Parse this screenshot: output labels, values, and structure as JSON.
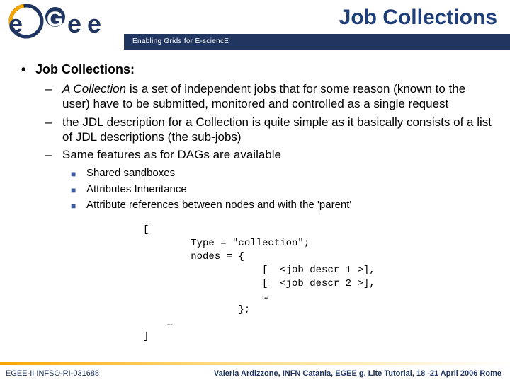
{
  "header": {
    "title": "Job Collections",
    "tagline": "Enabling Grids for E-sciencE",
    "logo_letters": [
      "e",
      "G",
      "e",
      "e"
    ]
  },
  "content": {
    "h1": "Job Collections:",
    "sub": [
      {
        "em": "A Collection",
        "rest": " is a set of independent jobs that for some reason (known to the user) have to be submitted, monitored and controlled as a single request"
      },
      {
        "text": "the JDL description for a Collection is quite simple as it basically consists of a list of JDL descriptions (the sub-jobs)"
      },
      {
        "text": "Same features as for DAGs are available"
      }
    ],
    "features": [
      "Shared sandboxes",
      "Attributes Inheritance",
      "Attribute references between nodes and with the 'parent'"
    ],
    "code": "[\n        Type = \"collection\";\n        nodes = {\n                    [  <job descr 1 >],\n                    [  <job descr 2 >],\n                    …\n                };\n    …\n]"
  },
  "footer": {
    "left": "EGEE-II INFSO-RI-031688",
    "right": "Valeria Ardizzone, INFN Catania, EGEE g. Lite Tutorial, 18 -21 April 2006 Rome"
  }
}
